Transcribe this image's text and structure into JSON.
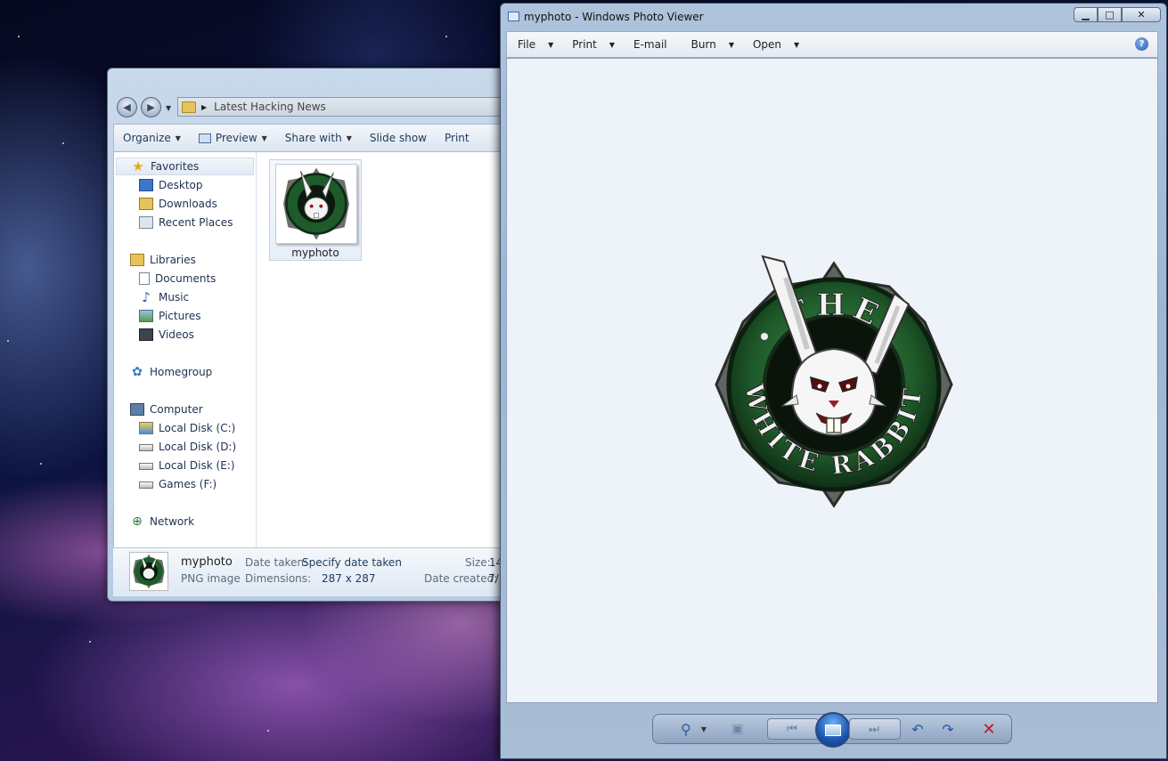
{
  "explorer": {
    "address": "Latest Hacking News",
    "toolbar": {
      "organize": "Organize",
      "preview": "Preview",
      "share_with": "Share with",
      "slide_show": "Slide show",
      "print": "Print"
    },
    "nav": {
      "favorites": "Favorites",
      "desktop": "Desktop",
      "downloads": "Downloads",
      "recent_places": "Recent Places",
      "libraries": "Libraries",
      "documents": "Documents",
      "music": "Music",
      "pictures": "Pictures",
      "videos": "Videos",
      "homegroup": "Homegroup",
      "computer": "Computer",
      "local_c": "Local Disk (C:)",
      "local_d": "Local Disk (D:)",
      "local_e": "Local Disk (E:)",
      "games_f": "Games (F:)",
      "network": "Network"
    },
    "file": {
      "name": "myphoto"
    },
    "details": {
      "name": "myphoto",
      "type": "PNG image",
      "date_taken_label": "Date taken:",
      "date_taken_value": "Specify date taken",
      "dimensions_label": "Dimensions:",
      "dimensions_value": "287 x 287",
      "size_label": "Size:",
      "size_value": "14",
      "date_created_label": "Date created:",
      "date_created_value": "7/"
    }
  },
  "viewer": {
    "title": "myphoto - Windows Photo Viewer",
    "menu": {
      "file": "File",
      "print": "Print",
      "email": "E-mail",
      "burn": "Burn",
      "open": "Open"
    },
    "help": "?",
    "image_text": {
      "top": "THE",
      "bottom": "WHITE RABBIT"
    }
  },
  "colors": {
    "accent": "#1e395b",
    "logo_green": "#1f5a2a",
    "delete_red": "#c8141a"
  }
}
